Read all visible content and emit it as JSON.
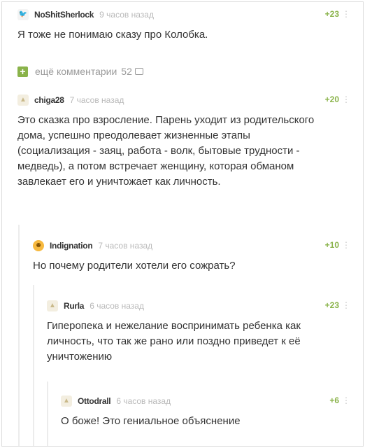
{
  "comments": [
    {
      "author": "NoShitSherlock",
      "time": "9 часов назад",
      "rating": "+23",
      "more": "⋮",
      "avatar_icon": "🐦",
      "text": "Я тоже не понимаю сказу про Колобка."
    },
    {
      "author": "chiga28",
      "time": "7 часов назад",
      "rating": "+20",
      "more": "⋮",
      "avatar_icon": "▲",
      "text": "Это сказка про взросление. Парень уходит из родительского дома, успешно преодолевает жизненные этапы (социализация - заяц, работа - волк, бытовые трудности - медведь), а потом встречает женщину, которая обманом завлекает его и уничтожает как личность."
    },
    {
      "author": "Indignation",
      "time": "7 часов назад",
      "rating": "+10",
      "more": "⋮",
      "avatar_icon": "☻",
      "text": "Но почему родители хотели его сожрать?"
    },
    {
      "author": "Rurla",
      "time": "6 часов назад",
      "rating": "+23",
      "more": "⋮",
      "avatar_icon": "▲",
      "text": "Гиперопека и нежелание воспринимать ребенка как личность, что так же рано или поздно приведет к её уничтожению"
    },
    {
      "author": "Ottodrall",
      "time": "6 часов назад",
      "rating": "+6",
      "more": "⋮",
      "avatar_icon": "▲",
      "text": "О боже! Это гениальное объяснение"
    }
  ],
  "more_comments": {
    "plus": "+",
    "label": "ещё комментарии",
    "count": "52"
  },
  "colors": {
    "rating": "#8ab34a",
    "time": "#b9b9b9",
    "plus_button": "#8ab34a"
  }
}
